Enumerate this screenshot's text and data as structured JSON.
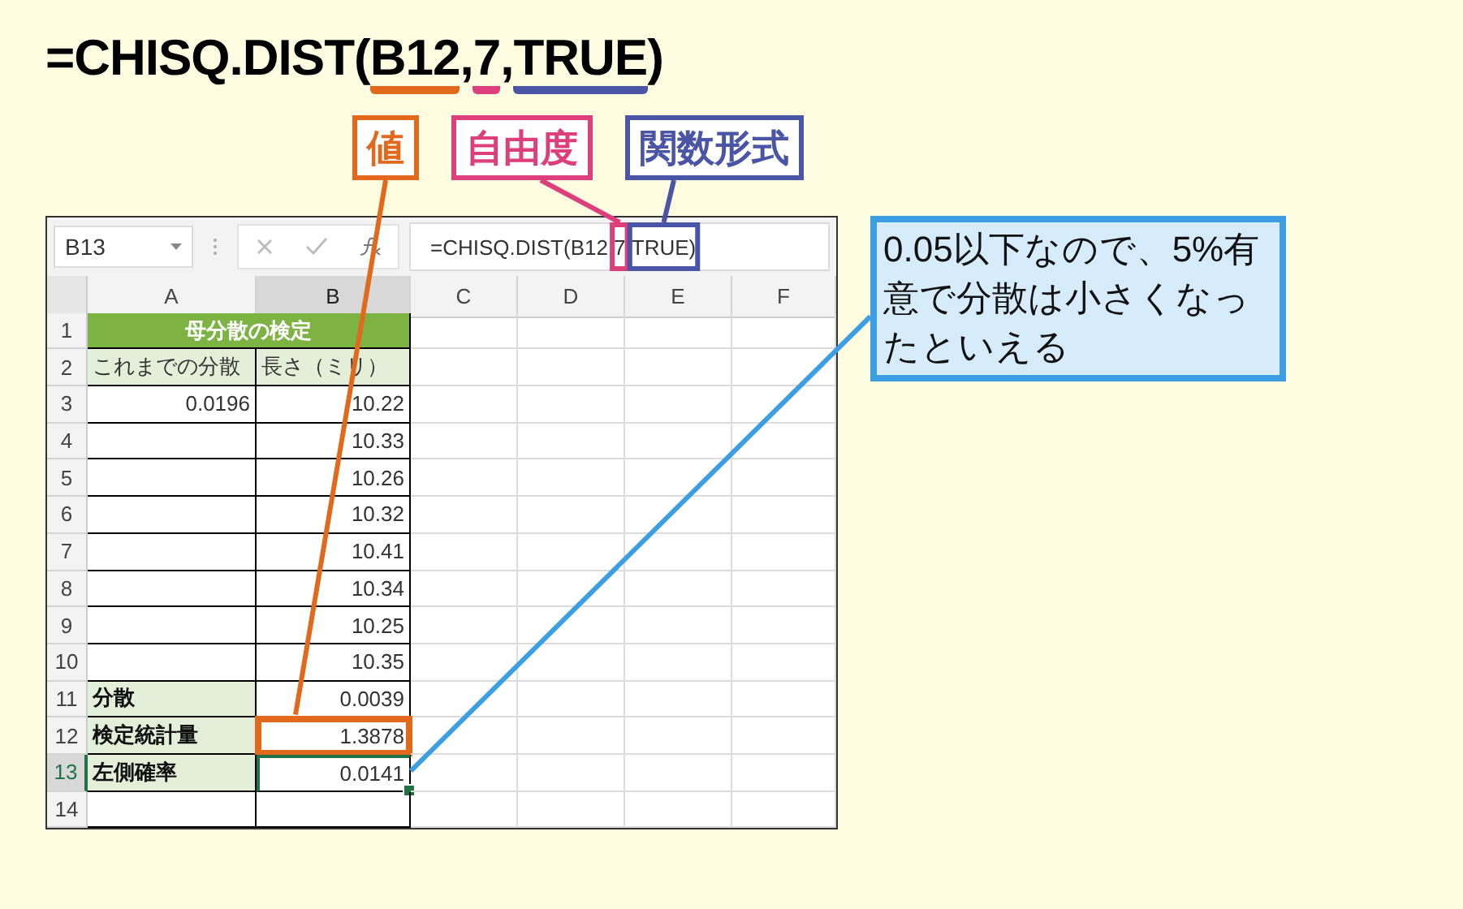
{
  "heading": {
    "segments": [
      {
        "text": "=CHISQ.DIST("
      },
      {
        "text": "B12",
        "color": "#e2691c"
      },
      {
        "text": ","
      },
      {
        "text": "7",
        "color": "#dc3f7c"
      },
      {
        "text": ","
      },
      {
        "text": "TRUE",
        "color": "#4a55a6"
      },
      {
        "text": ")"
      }
    ]
  },
  "labels": [
    {
      "text": "値",
      "color": "#e2691c",
      "kind": "cell"
    },
    {
      "text": "自由度",
      "color": "#dc3f7c",
      "kind": "formula"
    },
    {
      "text": "関数形式",
      "color": "#4a55a6",
      "kind": "formula"
    }
  ],
  "callout": {
    "text": "0.05以下なので、5%有意で分散は小さくなったといえる"
  },
  "spreadsheet": {
    "name_box": "B13",
    "formula": "=CHISQ.DIST(B12,7,TRUE)",
    "columns": [
      {
        "label": "A",
        "selected": false
      },
      {
        "label": "B",
        "selected": true
      },
      {
        "label": "C",
        "selected": false
      },
      {
        "label": "D",
        "selected": false
      },
      {
        "label": "E",
        "selected": false
      },
      {
        "label": "F",
        "selected": false
      }
    ],
    "rows": [
      {
        "number": "1",
        "selected": false,
        "cells": [
          {
            "text": "母分散の検定",
            "kind": "title",
            "selected": false,
            "marked": false
          }
        ]
      },
      {
        "number": "2",
        "selected": false,
        "cells": [
          {
            "text": "これまでの分散",
            "kind": "header",
            "selected": false,
            "marked": false
          },
          {
            "text": "長さ（ミリ）",
            "kind": "header",
            "selected": false,
            "marked": false
          }
        ]
      },
      {
        "number": "3",
        "selected": false,
        "cells": [
          {
            "text": "0.0196",
            "kind": "value",
            "selected": false,
            "marked": false
          },
          {
            "text": "10.22",
            "kind": "value",
            "selected": false,
            "marked": false
          }
        ]
      },
      {
        "number": "4",
        "selected": false,
        "cells": [
          {
            "kind": "value",
            "selected": false,
            "marked": false
          },
          {
            "text": "10.33",
            "kind": "value",
            "selected": false,
            "marked": false
          }
        ]
      },
      {
        "number": "5",
        "selected": false,
        "cells": [
          {
            "kind": "value",
            "selected": false,
            "marked": false
          },
          {
            "text": "10.26",
            "kind": "value",
            "selected": false,
            "marked": false
          }
        ]
      },
      {
        "number": "6",
        "selected": false,
        "cells": [
          {
            "kind": "value",
            "selected": false,
            "marked": false
          },
          {
            "text": "10.32",
            "kind": "value",
            "selected": false,
            "marked": false
          }
        ]
      },
      {
        "number": "7",
        "selected": false,
        "cells": [
          {
            "kind": "value",
            "selected": false,
            "marked": false
          },
          {
            "text": "10.41",
            "kind": "value",
            "selected": false,
            "marked": false
          }
        ]
      },
      {
        "number": "8",
        "selected": false,
        "cells": [
          {
            "kind": "value",
            "selected": false,
            "marked": false
          },
          {
            "text": "10.34",
            "kind": "value",
            "selected": false,
            "marked": false
          }
        ]
      },
      {
        "number": "9",
        "selected": false,
        "cells": [
          {
            "kind": "value",
            "selected": false,
            "marked": false
          },
          {
            "text": "10.25",
            "kind": "value",
            "selected": false,
            "marked": false
          }
        ]
      },
      {
        "number": "10",
        "selected": false,
        "cells": [
          {
            "kind": "value",
            "selected": false,
            "marked": false
          },
          {
            "text": "10.35",
            "kind": "value",
            "selected": false,
            "marked": false
          }
        ]
      },
      {
        "number": "11",
        "selected": false,
        "cells": [
          {
            "text": "分散",
            "kind": "label",
            "selected": false,
            "marked": false
          },
          {
            "text": "0.0039",
            "kind": "value",
            "selected": false,
            "marked": false
          }
        ]
      },
      {
        "number": "12",
        "selected": false,
        "cells": [
          {
            "text": "検定統計量",
            "kind": "label",
            "selected": false,
            "marked": false
          },
          {
            "text": "1.3878",
            "kind": "value",
            "selected": false,
            "marked": true
          }
        ]
      },
      {
        "number": "13",
        "selected": true,
        "cells": [
          {
            "text": "左側確率",
            "kind": "label",
            "selected": false,
            "marked": false
          },
          {
            "text": "0.0141",
            "kind": "value",
            "selected": true,
            "marked": false
          }
        ]
      },
      {
        "number": "14",
        "selected": false
      }
    ]
  }
}
